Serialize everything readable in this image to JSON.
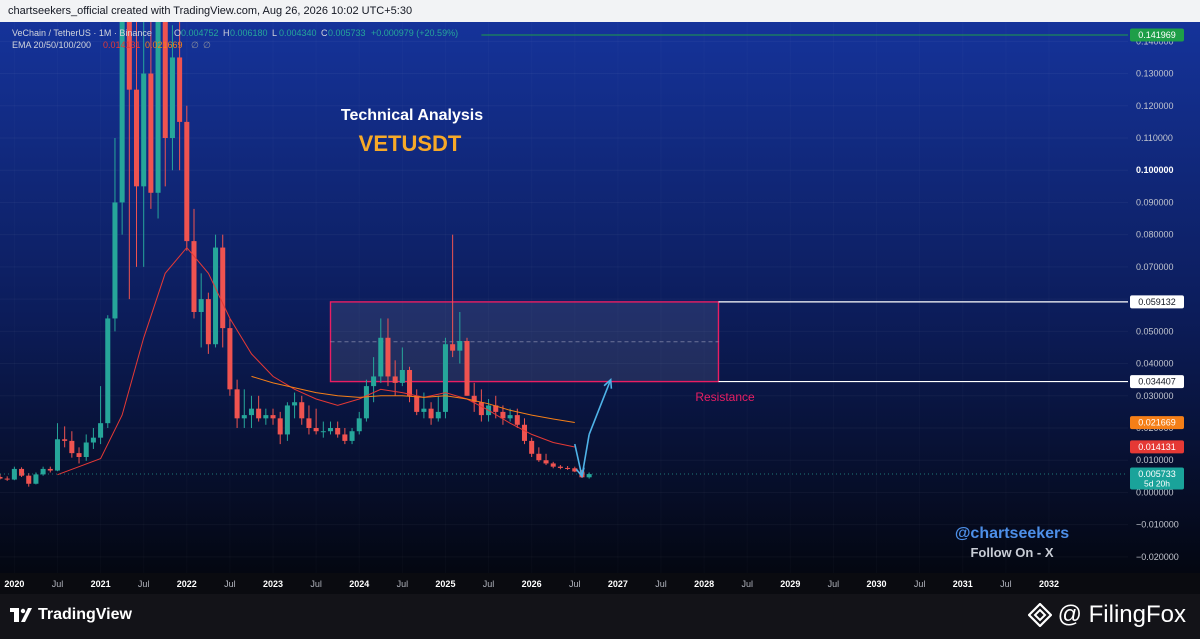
{
  "header": {
    "credit": "chartseekers_official created with TradingView.com, Aug 26, 2026 10:02 UTC+5:30"
  },
  "legend": {
    "symbol": "VeChain / TetherUS · 1M · Binance",
    "ohlc": [
      {
        "label": "O",
        "value": "0.004752"
      },
      {
        "label": "H",
        "value": "0.006180"
      },
      {
        "label": "L",
        "value": "0.004340"
      },
      {
        "label": "C",
        "value": "0.005733"
      }
    ],
    "change": "+0.000979 (+20.59%)",
    "ema_label": "EMA 20/50/100/200",
    "ema_values": [
      "0.014131",
      "0.021669"
    ],
    "ema_null_marks": [
      "∅",
      "∅"
    ]
  },
  "annotations": {
    "title": "Technical Analysis",
    "symbol": "VETUSDT",
    "resistance": "Resistance",
    "handle": "@chartseekers",
    "follow": "Follow On - X"
  },
  "price_tags": [
    {
      "value": 0.141969,
      "label": "0.141969",
      "color": "#1e9e48",
      "text_color": "#ffffff"
    },
    {
      "value": 0.059132,
      "label": "0.059132",
      "color": "#ffffff",
      "text_color": "#131722"
    },
    {
      "value": 0.034407,
      "label": "0.034407",
      "color": "#ffffff",
      "text_color": "#131722"
    },
    {
      "value": 0.021669,
      "label": "0.021669",
      "color": "#f57f17",
      "text_color": "#ffffff"
    },
    {
      "value": 0.014131,
      "label": "0.014131",
      "color": "#e53935",
      "text_color": "#ffffff"
    },
    {
      "value": 0.005733,
      "label": "0.005733",
      "sublabel": "5d 20h",
      "color": "#1aa39a",
      "text_color": "#ffffff"
    }
  ],
  "footer": {
    "tradingview": "TradingView",
    "filingfox": "@ FilingFox"
  },
  "colors": {
    "bull": "#26a69a",
    "bear": "#ef5350",
    "ema_20": "#e53935",
    "ema_50": "#f57f17",
    "zone_border": "#e91e63",
    "arrow": "#4fb3e8",
    "target_line": "#1e9e48",
    "title_color": "#ffffff",
    "symbol_color": "#f7a928",
    "handle_color": "#4d8fe8"
  },
  "chart_data": {
    "type": "candlestick",
    "title": "Technical Analysis",
    "subtitle": "VETUSDT",
    "timeframe": "1M",
    "y_scale": "linear",
    "ylim": [
      -0.025,
      0.146
    ],
    "y_ticks": [
      -0.02,
      -0.01,
      0.0,
      0.01,
      0.02,
      0.03,
      0.04,
      0.05,
      0.06,
      0.07,
      0.08,
      0.09,
      0.1,
      0.11,
      0.12,
      0.13,
      0.14
    ],
    "y_tick_labels": [
      "−0.020000",
      "−0.010000",
      "0.000000",
      "0.010000",
      "0.020000",
      "0.030000",
      "0.040000",
      "0.050000",
      "0.060000",
      "0.070000",
      "0.080000",
      "0.090000",
      "0.100000",
      "0.110000",
      "0.120000",
      "0.130000",
      "0.140000"
    ],
    "xlim": [
      "2019-11",
      "2032-12"
    ],
    "x_ticks": [
      {
        "date": "2020-01",
        "label": "2020"
      },
      {
        "date": "2020-07",
        "label": "Jul"
      },
      {
        "date": "2021-01",
        "label": "2021"
      },
      {
        "date": "2021-07",
        "label": "Jul"
      },
      {
        "date": "2022-01",
        "label": "2022"
      },
      {
        "date": "2022-07",
        "label": "Jul"
      },
      {
        "date": "2023-01",
        "label": "2023"
      },
      {
        "date": "2023-07",
        "label": "Jul"
      },
      {
        "date": "2024-01",
        "label": "2024"
      },
      {
        "date": "2024-07",
        "label": "Jul"
      },
      {
        "date": "2025-01",
        "label": "2025"
      },
      {
        "date": "2025-07",
        "label": "Jul"
      },
      {
        "date": "2026-01",
        "label": "2026"
      },
      {
        "date": "2026-07",
        "label": "Jul"
      },
      {
        "date": "2027-01",
        "label": "2027"
      },
      {
        "date": "2027-07",
        "label": "Jul"
      },
      {
        "date": "2028-01",
        "label": "2028"
      },
      {
        "date": "2028-07",
        "label": "Jul"
      },
      {
        "date": "2029-01",
        "label": "2029"
      },
      {
        "date": "2029-07",
        "label": "Jul"
      },
      {
        "date": "2030-01",
        "label": "2030"
      },
      {
        "date": "2030-07",
        "label": "Jul"
      },
      {
        "date": "2031-01",
        "label": "2031"
      },
      {
        "date": "2031-07",
        "label": "Jul"
      },
      {
        "date": "2032-01",
        "label": "2032"
      }
    ],
    "first_candle": "2019-11",
    "candles_ohlc": [
      [
        0.0048,
        0.0058,
        0.004,
        0.0043
      ],
      [
        0.0043,
        0.005,
        0.0036,
        0.004
      ],
      [
        0.004,
        0.008,
        0.0038,
        0.0073
      ],
      [
        0.0073,
        0.0078,
        0.0048,
        0.0052
      ],
      [
        0.0052,
        0.006,
        0.0018,
        0.0027
      ],
      [
        0.0027,
        0.0062,
        0.0025,
        0.0056
      ],
      [
        0.0056,
        0.008,
        0.0052,
        0.0073
      ],
      [
        0.0073,
        0.008,
        0.0062,
        0.0068
      ],
      [
        0.0068,
        0.0215,
        0.0066,
        0.0165
      ],
      [
        0.0165,
        0.0205,
        0.014,
        0.016
      ],
      [
        0.016,
        0.019,
        0.0108,
        0.0122
      ],
      [
        0.0122,
        0.014,
        0.009,
        0.011
      ],
      [
        0.011,
        0.018,
        0.0098,
        0.0155
      ],
      [
        0.0155,
        0.02,
        0.0135,
        0.017
      ],
      [
        0.017,
        0.033,
        0.015,
        0.0215
      ],
      [
        0.0215,
        0.055,
        0.02,
        0.054
      ],
      [
        0.054,
        0.11,
        0.05,
        0.09
      ],
      [
        0.09,
        0.28,
        0.08,
        0.18
      ],
      [
        0.18,
        0.27,
        0.06,
        0.125
      ],
      [
        0.125,
        0.18,
        0.07,
        0.095
      ],
      [
        0.095,
        0.15,
        0.07,
        0.13
      ],
      [
        0.13,
        0.16,
        0.088,
        0.093
      ],
      [
        0.093,
        0.165,
        0.085,
        0.155
      ],
      [
        0.155,
        0.2,
        0.095,
        0.11
      ],
      [
        0.11,
        0.145,
        0.1,
        0.135
      ],
      [
        0.135,
        0.15,
        0.1,
        0.115
      ],
      [
        0.115,
        0.12,
        0.075,
        0.078
      ],
      [
        0.078,
        0.088,
        0.054,
        0.056
      ],
      [
        0.056,
        0.068,
        0.045,
        0.06
      ],
      [
        0.06,
        0.062,
        0.043,
        0.046
      ],
      [
        0.046,
        0.08,
        0.045,
        0.076
      ],
      [
        0.076,
        0.08,
        0.045,
        0.051
      ],
      [
        0.051,
        0.054,
        0.03,
        0.032
      ],
      [
        0.032,
        0.035,
        0.02,
        0.023
      ],
      [
        0.023,
        0.032,
        0.02,
        0.024
      ],
      [
        0.024,
        0.03,
        0.02,
        0.026
      ],
      [
        0.026,
        0.03,
        0.022,
        0.023
      ],
      [
        0.023,
        0.026,
        0.021,
        0.024
      ],
      [
        0.024,
        0.026,
        0.021,
        0.023
      ],
      [
        0.023,
        0.025,
        0.015,
        0.018
      ],
      [
        0.018,
        0.028,
        0.016,
        0.027
      ],
      [
        0.027,
        0.031,
        0.023,
        0.028
      ],
      [
        0.028,
        0.03,
        0.021,
        0.023
      ],
      [
        0.023,
        0.027,
        0.018,
        0.02
      ],
      [
        0.02,
        0.026,
        0.018,
        0.019
      ],
      [
        0.019,
        0.022,
        0.017,
        0.019
      ],
      [
        0.019,
        0.022,
        0.018,
        0.02
      ],
      [
        0.02,
        0.022,
        0.017,
        0.018
      ],
      [
        0.018,
        0.02,
        0.015,
        0.016
      ],
      [
        0.016,
        0.02,
        0.015,
        0.019
      ],
      [
        0.019,
        0.025,
        0.018,
        0.023
      ],
      [
        0.023,
        0.035,
        0.022,
        0.033
      ],
      [
        0.033,
        0.042,
        0.028,
        0.036
      ],
      [
        0.036,
        0.054,
        0.034,
        0.048
      ],
      [
        0.048,
        0.054,
        0.033,
        0.036
      ],
      [
        0.036,
        0.041,
        0.03,
        0.034
      ],
      [
        0.034,
        0.045,
        0.033,
        0.038
      ],
      [
        0.038,
        0.039,
        0.028,
        0.03
      ],
      [
        0.03,
        0.032,
        0.024,
        0.025
      ],
      [
        0.025,
        0.031,
        0.023,
        0.026
      ],
      [
        0.026,
        0.028,
        0.021,
        0.023
      ],
      [
        0.023,
        0.03,
        0.022,
        0.025
      ],
      [
        0.025,
        0.048,
        0.023,
        0.046
      ],
      [
        0.046,
        0.08,
        0.042,
        0.044
      ],
      [
        0.044,
        0.056,
        0.04,
        0.047
      ],
      [
        0.047,
        0.048,
        0.03,
        0.03
      ],
      [
        0.03,
        0.034,
        0.025,
        0.028
      ],
      [
        0.028,
        0.032,
        0.022,
        0.024
      ],
      [
        0.024,
        0.029,
        0.022,
        0.027
      ],
      [
        0.027,
        0.03,
        0.023,
        0.025
      ],
      [
        0.025,
        0.027,
        0.021,
        0.023
      ],
      [
        0.023,
        0.026,
        0.022,
        0.024
      ],
      [
        0.024,
        0.026,
        0.02,
        0.021
      ],
      [
        0.021,
        0.023,
        0.015,
        0.016
      ],
      [
        0.016,
        0.017,
        0.011,
        0.012
      ],
      [
        0.012,
        0.014,
        0.0095,
        0.01
      ],
      [
        0.01,
        0.012,
        0.0085,
        0.009
      ],
      [
        0.009,
        0.0095,
        0.0075,
        0.008
      ],
      [
        0.008,
        0.0085,
        0.0072,
        0.0076
      ],
      [
        0.0076,
        0.0082,
        0.007,
        0.0075
      ],
      [
        0.0075,
        0.008,
        0.0063,
        0.0065
      ],
      [
        0.0065,
        0.007,
        0.0045,
        0.0047
      ],
      [
        0.0047,
        0.0062,
        0.0043,
        0.0057
      ]
    ],
    "ema_20_points": [
      [
        "2020-07",
        0.0055
      ],
      [
        "2021-01",
        0.0105
      ],
      [
        "2021-04",
        0.024
      ],
      [
        "2021-07",
        0.048
      ],
      [
        "2021-10",
        0.068
      ],
      [
        "2022-01",
        0.076
      ],
      [
        "2022-04",
        0.068
      ],
      [
        "2022-07",
        0.054
      ],
      [
        "2022-10",
        0.043
      ],
      [
        "2023-01",
        0.036
      ],
      [
        "2023-04",
        0.032
      ],
      [
        "2023-07",
        0.029
      ],
      [
        "2023-10",
        0.027
      ],
      [
        "2024-01",
        0.029
      ],
      [
        "2024-04",
        0.032
      ],
      [
        "2024-07",
        0.031
      ],
      [
        "2024-10",
        0.0295
      ],
      [
        "2025-01",
        0.031
      ],
      [
        "2025-04",
        0.029
      ],
      [
        "2025-07",
        0.0255
      ],
      [
        "2025-10",
        0.0215
      ],
      [
        "2026-01",
        0.018
      ],
      [
        "2026-04",
        0.0155
      ],
      [
        "2026-07",
        0.0141
      ]
    ],
    "ema_50_points": [
      [
        "2022-10",
        0.036
      ],
      [
        "2023-01",
        0.034
      ],
      [
        "2023-04",
        0.0325
      ],
      [
        "2023-07",
        0.031
      ],
      [
        "2023-10",
        0.03
      ],
      [
        "2024-01",
        0.0295
      ],
      [
        "2024-04",
        0.03
      ],
      [
        "2024-07",
        0.03
      ],
      [
        "2024-10",
        0.0295
      ],
      [
        "2025-01",
        0.03
      ],
      [
        "2025-04",
        0.029
      ],
      [
        "2025-07",
        0.0275
      ],
      [
        "2025-10",
        0.0255
      ],
      [
        "2026-01",
        0.024
      ],
      [
        "2026-04",
        0.0228
      ],
      [
        "2026-07",
        0.0217
      ]
    ],
    "resistance_zone": {
      "x_start": "2023-09",
      "x_end": "2028-03",
      "y_low": 0.034407,
      "y_high": 0.059132,
      "label": "Resistance"
    },
    "target_line": {
      "value": 0.141969,
      "x_start": "2025-06"
    },
    "projection_arrows": [
      {
        "from": [
          "2026-07",
          0.015
        ],
        "to": [
          "2026-08",
          0.005
        ]
      },
      {
        "from": [
          "2026-08",
          0.005
        ],
        "to": [
          "2026-09",
          0.018
        ]
      },
      {
        "from": [
          "2026-09",
          0.018
        ],
        "to": [
          "2026-12",
          0.035
        ]
      }
    ]
  }
}
